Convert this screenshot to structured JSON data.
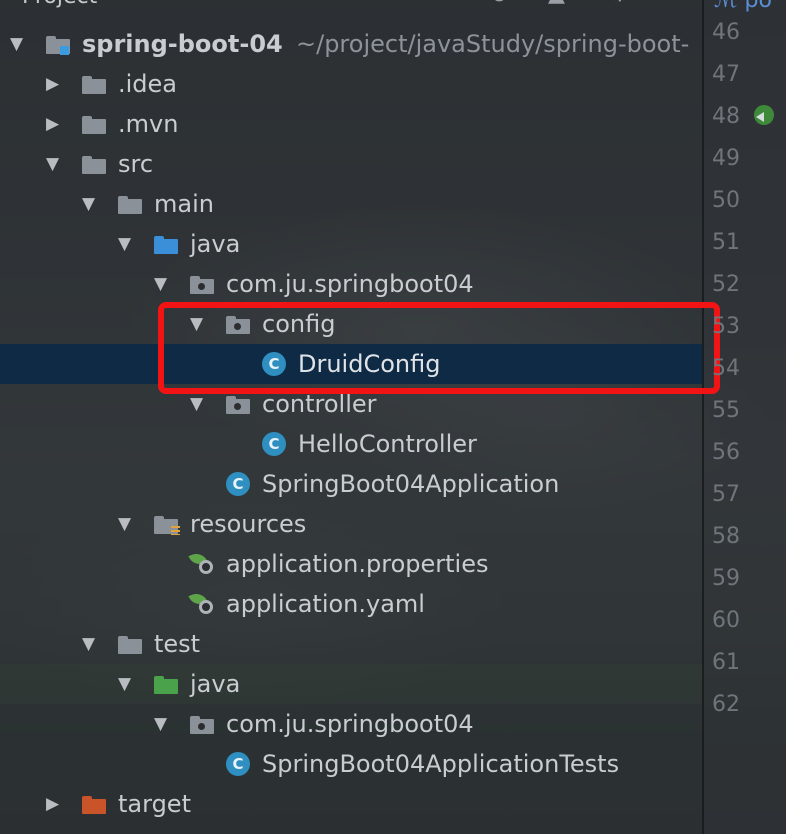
{
  "toolbar": {
    "title": "Project",
    "dropdown_icon": "chevron-down-icon"
  },
  "editor_tab": {
    "label": "po"
  },
  "tree": {
    "root": {
      "label": "spring-boot-04",
      "path": "~/project/javaStudy/spring-boot-"
    },
    "items": [
      {
        "label": ".idea"
      },
      {
        "label": ".mvn"
      },
      {
        "label": "src"
      },
      {
        "label": "main"
      },
      {
        "label": "java"
      },
      {
        "label": "com.ju.springboot04"
      },
      {
        "label": "config"
      },
      {
        "label": "DruidConfig"
      },
      {
        "label": "controller"
      },
      {
        "label": "HelloController"
      },
      {
        "label": "SpringBoot04Application"
      },
      {
        "label": "resources"
      },
      {
        "label": "application.properties"
      },
      {
        "label": "application.yaml"
      },
      {
        "label": "test"
      },
      {
        "label": "java"
      },
      {
        "label": "com.ju.springboot04"
      },
      {
        "label": "SpringBoot04ApplicationTests"
      },
      {
        "label": "target"
      }
    ],
    "class_icon_letter": "C"
  },
  "line_numbers": [
    "46",
    "47",
    "48",
    "49",
    "50",
    "51",
    "52",
    "53",
    "54",
    "55",
    "56",
    "57",
    "58",
    "59",
    "60",
    "61",
    "62"
  ],
  "colors": {
    "selection": "#0e2a45",
    "highlight_box": "#f21414",
    "folder": "#8a9199",
    "source_folder": "#3a8fd8",
    "test_folder": "#4aa34a",
    "target_folder": "#c9542a",
    "class_icon": "#2f8fc0"
  }
}
